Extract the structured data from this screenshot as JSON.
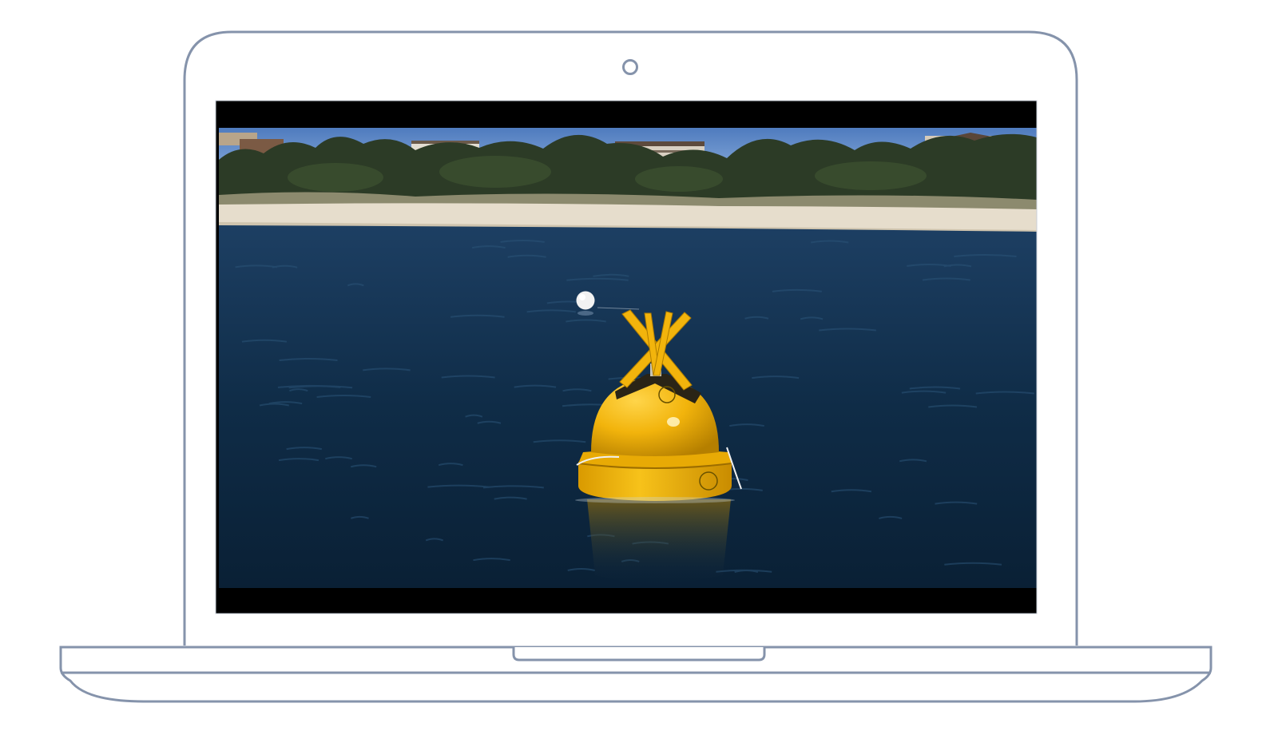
{
  "frame": {
    "outline_color": "#8593ab",
    "background_color": "#ffffff"
  },
  "video": {
    "letterbox_color": "#000000",
    "scene": {
      "sky_color": "#5b84c4",
      "sand_color": "#e6ddcc",
      "water_color": "#0f2e4a",
      "foliage_color": "#2c3b26",
      "buoy_color": "#f2b40c",
      "float_color": "#f2f2f2"
    }
  },
  "icons": {
    "camera": "camera-icon",
    "trackpad": "trackpad-notch"
  }
}
